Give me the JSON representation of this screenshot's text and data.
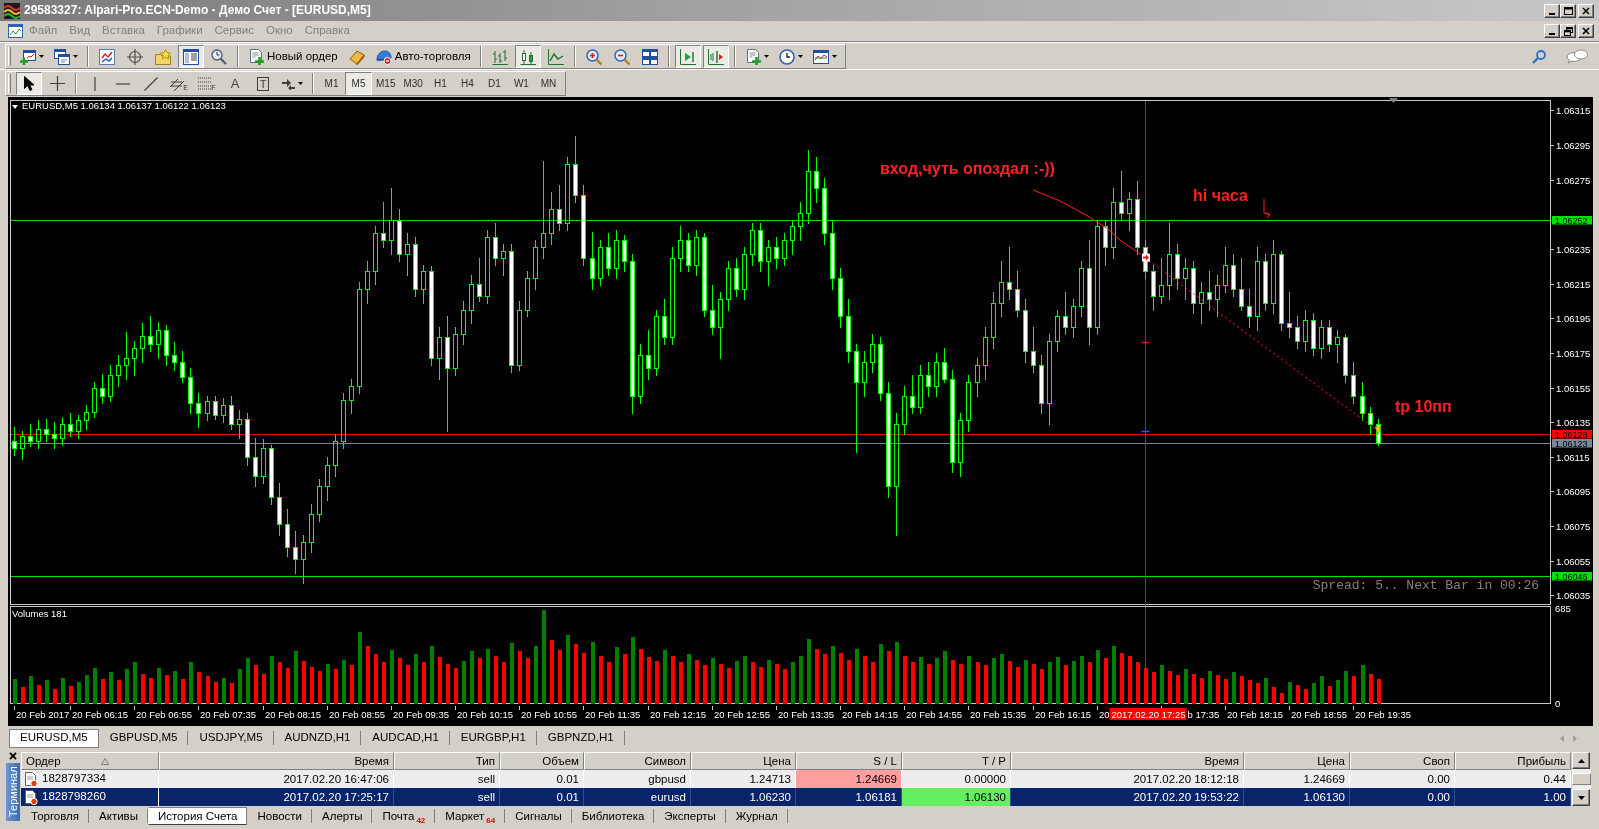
{
  "window": {
    "title": "29583327: Alpari-Pro.ECN-Demo - Демо Счет - [EURUSD,M5]"
  },
  "menu": [
    "Файл",
    "Вид",
    "Вставка",
    "Графики",
    "Сервис",
    "Окно",
    "Справка"
  ],
  "toolbar": [
    [
      {
        "kind": "new-chart",
        "pressed": false
      },
      {
        "kind": "profiles",
        "pressed": false
      }
    ],
    [
      {
        "kind": "market-watch",
        "pressed": false
      },
      {
        "kind": "data-window",
        "pressed": false
      },
      {
        "kind": "navigator",
        "pressed": false
      },
      {
        "kind": "terminal",
        "pressed": true
      },
      {
        "kind": "tester",
        "pressed": false
      }
    ],
    [
      {
        "kind": "new-order",
        "label": "Новый ордер",
        "pressed": false
      },
      {
        "kind": "editor",
        "pressed": false
      },
      {
        "kind": "autotrading",
        "label": "Авто-торговля",
        "pressed": false
      }
    ],
    [
      {
        "kind": "bars",
        "pressed": false
      },
      {
        "kind": "candles",
        "pressed": true
      },
      {
        "kind": "line",
        "pressed": false
      }
    ],
    [
      {
        "kind": "zoom-in",
        "pressed": false
      },
      {
        "kind": "zoom-out",
        "pressed": false
      },
      {
        "kind": "tile",
        "pressed": false
      }
    ],
    [
      {
        "kind": "autoscroll",
        "pressed": true
      },
      {
        "kind": "shift",
        "pressed": true
      }
    ],
    [
      {
        "kind": "indicators",
        "pressed": false
      },
      {
        "kind": "periods",
        "pressed": false
      },
      {
        "kind": "templates",
        "pressed": false
      }
    ]
  ],
  "drawing_tools": [
    [
      {
        "kind": "cursor",
        "selected": true
      },
      {
        "kind": "crosshair",
        "selected": false
      }
    ],
    [
      {
        "kind": "vline",
        "selected": false
      },
      {
        "kind": "hline",
        "selected": false
      },
      {
        "kind": "trendline",
        "selected": false
      },
      {
        "kind": "channel",
        "glyph": "E",
        "selected": false
      },
      {
        "kind": "fibo",
        "glyph": "F",
        "selected": false
      },
      {
        "kind": "text",
        "glyph": "A",
        "selected": false
      },
      {
        "kind": "label",
        "glyph": "T",
        "selected": false
      },
      {
        "kind": "arrows",
        "selected": false
      }
    ]
  ],
  "timeframes": [
    {
      "label": "M1",
      "selected": false
    },
    {
      "label": "M5",
      "selected": true
    },
    {
      "label": "M15",
      "selected": false
    },
    {
      "label": "M30",
      "selected": false
    },
    {
      "label": "H1",
      "selected": false
    },
    {
      "label": "H4",
      "selected": false
    },
    {
      "label": "D1",
      "selected": false
    },
    {
      "label": "W1",
      "selected": false
    },
    {
      "label": "MN",
      "selected": false
    }
  ],
  "chart": {
    "comment": "Spread: 5.. Next Bar in 00:26",
    "chart_data": [
      {
        "type": "candlestick",
        "title": "EURUSD,M5 1.06134 1.06137 1.06122 1.06123",
        "color": "#00ff00",
        "tick_labels": "y",
        "ylim": [
          1.0603,
          1.06321
        ],
        "yticks": [
          1.06035,
          1.06055,
          1.06075,
          1.06095,
          1.06115,
          1.06135,
          1.06155,
          1.06175,
          1.06195,
          1.06215,
          1.06235,
          1.06275,
          1.06295,
          1.06315
        ],
        "ohlc": [
          [
            1.06124,
            1.06132,
            1.06116,
            1.0612
          ],
          [
            1.0612,
            1.0613,
            1.06114,
            1.06127
          ],
          [
            1.06127,
            1.06134,
            1.06121,
            1.06124
          ],
          [
            1.06124,
            1.06136,
            1.0612,
            1.06131
          ],
          [
            1.06131,
            1.06137,
            1.06124,
            1.06128
          ],
          [
            1.06128,
            1.06135,
            1.0612,
            1.06126
          ],
          [
            1.06126,
            1.06138,
            1.06122,
            1.06134
          ],
          [
            1.06134,
            1.0614,
            1.06127,
            1.0613
          ],
          [
            1.0613,
            1.06139,
            1.06126,
            1.06136
          ],
          [
            1.06136,
            1.06145,
            1.06131,
            1.06141
          ],
          [
            1.06141,
            1.06158,
            1.06138,
            1.06155
          ],
          [
            1.06155,
            1.06163,
            1.06146,
            1.0615
          ],
          [
            1.0615,
            1.06168,
            1.06147,
            1.06162
          ],
          [
            1.06162,
            1.06174,
            1.06156,
            1.06168
          ],
          [
            1.06168,
            1.06187,
            1.0616,
            1.06172
          ],
          [
            1.06172,
            1.06182,
            1.06162,
            1.06178
          ],
          [
            1.06178,
            1.06192,
            1.0617,
            1.06185
          ],
          [
            1.06185,
            1.06196,
            1.06176,
            1.0618
          ],
          [
            1.0618,
            1.06193,
            1.06172,
            1.06188
          ],
          [
            1.06188,
            1.06191,
            1.06168,
            1.06174
          ],
          [
            1.06174,
            1.06181,
            1.06165,
            1.0617
          ],
          [
            1.0617,
            1.06176,
            1.06158,
            1.06161
          ],
          [
            1.06161,
            1.06166,
            1.0614,
            1.06146
          ],
          [
            1.06146,
            1.06152,
            1.06132,
            1.0614
          ],
          [
            1.0614,
            1.0615,
            1.06136,
            1.06147
          ],
          [
            1.06147,
            1.0615,
            1.06137,
            1.06139
          ],
          [
            1.06139,
            1.06149,
            1.06135,
            1.06145
          ],
          [
            1.06145,
            1.0615,
            1.06131,
            1.06134
          ],
          [
            1.06134,
            1.06142,
            1.06126,
            1.06137
          ],
          [
            1.06137,
            1.0614,
            1.0611,
            1.06115
          ],
          [
            1.06115,
            1.06126,
            1.06098,
            1.06104
          ],
          [
            1.06104,
            1.06125,
            1.061,
            1.0612
          ],
          [
            1.0612,
            1.06122,
            1.06088,
            1.06092
          ],
          [
            1.06092,
            1.061,
            1.0607,
            1.06076
          ],
          [
            1.06076,
            1.06085,
            1.06058,
            1.06063
          ],
          [
            1.06063,
            1.06072,
            1.06048,
            1.06056
          ],
          [
            1.06056,
            1.0607,
            1.06042,
            1.06066
          ],
          [
            1.06066,
            1.06088,
            1.0606,
            1.06082
          ],
          [
            1.06082,
            1.06102,
            1.06078,
            1.06098
          ],
          [
            1.06098,
            1.06115,
            1.0609,
            1.0611
          ],
          [
            1.0611,
            1.06128,
            1.06104,
            1.06124
          ],
          [
            1.06124,
            1.06152,
            1.0612,
            1.06148
          ],
          [
            1.06148,
            1.0616,
            1.0614,
            1.06156
          ],
          [
            1.06156,
            1.06216,
            1.06152,
            1.06212
          ],
          [
            1.06212,
            1.06228,
            1.06204,
            1.06222
          ],
          [
            1.06222,
            1.06248,
            1.06215,
            1.06244
          ],
          [
            1.06244,
            1.06262,
            1.06236,
            1.0624
          ],
          [
            1.0624,
            1.0627,
            1.06232,
            1.06252
          ],
          [
            1.06252,
            1.06258,
            1.06228,
            1.06232
          ],
          [
            1.06232,
            1.06244,
            1.0622,
            1.06238
          ],
          [
            1.06238,
            1.06242,
            1.06208,
            1.06212
          ],
          [
            1.06212,
            1.06226,
            1.06204,
            1.06222
          ],
          [
            1.06222,
            1.06225,
            1.06168,
            1.06172
          ],
          [
            1.06172,
            1.0619,
            1.0616,
            1.06184
          ],
          [
            1.06184,
            1.06196,
            1.0613,
            1.06166
          ],
          [
            1.06166,
            1.0619,
            1.06162,
            1.06186
          ],
          [
            1.06186,
            1.06205,
            1.0618,
            1.062
          ],
          [
            1.062,
            1.0622,
            1.06192,
            1.06215
          ],
          [
            1.06215,
            1.0623,
            1.06205,
            1.06208
          ],
          [
            1.06208,
            1.06246,
            1.06204,
            1.06242
          ],
          [
            1.06242,
            1.0625,
            1.06226,
            1.0623
          ],
          [
            1.0623,
            1.06238,
            1.0622,
            1.06234
          ],
          [
            1.06234,
            1.06238,
            1.06164,
            1.06168
          ],
          [
            1.06168,
            1.06205,
            1.06165,
            1.062
          ],
          [
            1.062,
            1.06222,
            1.06196,
            1.06218
          ],
          [
            1.06218,
            1.0624,
            1.06212,
            1.06236
          ],
          [
            1.06236,
            1.06286,
            1.0623,
            1.06244
          ],
          [
            1.06244,
            1.06268,
            1.06238,
            1.06258
          ],
          [
            1.06258,
            1.06272,
            1.06246,
            1.0625
          ],
          [
            1.0625,
            1.06288,
            1.06246,
            1.06284
          ],
          [
            1.06284,
            1.063,
            1.06262,
            1.06266
          ],
          [
            1.06266,
            1.06272,
            1.06226,
            1.0623
          ],
          [
            1.0623,
            1.06245,
            1.06212,
            1.06218
          ],
          [
            1.06218,
            1.0624,
            1.06214,
            1.06236
          ],
          [
            1.06236,
            1.06244,
            1.0622,
            1.06224
          ],
          [
            1.06224,
            1.06246,
            1.06218,
            1.0624
          ],
          [
            1.0624,
            1.06243,
            1.06222,
            1.06228
          ],
          [
            1.06228,
            1.06232,
            1.0614,
            1.0615
          ],
          [
            1.0615,
            1.0618,
            1.06146,
            1.06174
          ],
          [
            1.06174,
            1.06188,
            1.0616,
            1.06166
          ],
          [
            1.06166,
            1.062,
            1.06162,
            1.06196
          ],
          [
            1.06196,
            1.06206,
            1.0618,
            1.06184
          ],
          [
            1.06184,
            1.06236,
            1.0618,
            1.0623
          ],
          [
            1.0623,
            1.06248,
            1.06222,
            1.0624
          ],
          [
            1.0624,
            1.06244,
            1.06222,
            1.06226
          ],
          [
            1.06226,
            1.06246,
            1.0622,
            1.06242
          ],
          [
            1.06242,
            1.06244,
            1.06196,
            1.062
          ],
          [
            1.062,
            1.06214,
            1.06186,
            1.0619
          ],
          [
            1.0619,
            1.0621,
            1.06172,
            1.06206
          ],
          [
            1.06206,
            1.06228,
            1.062,
            1.06224
          ],
          [
            1.06224,
            1.0623,
            1.06208,
            1.06212
          ],
          [
            1.06212,
            1.06236,
            1.06206,
            1.06232
          ],
          [
            1.06232,
            1.0625,
            1.06226,
            1.06246
          ],
          [
            1.06246,
            1.0625,
            1.06222,
            1.06228
          ],
          [
            1.06228,
            1.0624,
            1.06214,
            1.06236
          ],
          [
            1.06236,
            1.06242,
            1.06224,
            1.0623
          ],
          [
            1.0623,
            1.06244,
            1.06226,
            1.0624
          ],
          [
            1.0624,
            1.06252,
            1.06232,
            1.06248
          ],
          [
            1.06248,
            1.06262,
            1.0624,
            1.06256
          ],
          [
            1.06256,
            1.06292,
            1.0625,
            1.0628
          ],
          [
            1.0628,
            1.06288,
            1.06262,
            1.0627
          ],
          [
            1.0627,
            1.06276,
            1.06238,
            1.06244
          ],
          [
            1.06244,
            1.06252,
            1.06212,
            1.06218
          ],
          [
            1.06218,
            1.06224,
            1.0619,
            1.06196
          ],
          [
            1.06196,
            1.06206,
            1.0617,
            1.06176
          ],
          [
            1.06176,
            1.0618,
            1.06118,
            1.06158
          ],
          [
            1.06158,
            1.06176,
            1.0615,
            1.0617
          ],
          [
            1.0617,
            1.06186,
            1.06164,
            1.0618
          ],
          [
            1.0618,
            1.06184,
            1.06148,
            1.06152
          ],
          [
            1.06152,
            1.06158,
            1.06092,
            1.06098
          ],
          [
            1.06098,
            1.0614,
            1.0607,
            1.06134
          ],
          [
            1.06134,
            1.06156,
            1.06128,
            1.0615
          ],
          [
            1.0615,
            1.06162,
            1.0614,
            1.06144
          ],
          [
            1.06144,
            1.06168,
            1.0614,
            1.06162
          ],
          [
            1.06162,
            1.0617,
            1.0615,
            1.06156
          ],
          [
            1.06156,
            1.06175,
            1.0615,
            1.0617
          ],
          [
            1.0617,
            1.06178,
            1.06158,
            1.0616
          ],
          [
            1.0616,
            1.06165,
            1.06106,
            1.06112
          ],
          [
            1.06112,
            1.0614,
            1.06104,
            1.06136
          ],
          [
            1.06136,
            1.06162,
            1.0613,
            1.06158
          ],
          [
            1.06158,
            1.06172,
            1.0615,
            1.06168
          ],
          [
            1.06168,
            1.0619,
            1.0616,
            1.06184
          ],
          [
            1.06184,
            1.0621,
            1.06178,
            1.06204
          ],
          [
            1.06204,
            1.06228,
            1.06196,
            1.06216
          ],
          [
            1.06216,
            1.06236,
            1.06206,
            1.06212
          ],
          [
            1.06212,
            1.06222,
            1.06196,
            1.062
          ],
          [
            1.062,
            1.06206,
            1.0617,
            1.06176
          ],
          [
            1.06176,
            1.0619,
            1.06164,
            1.06168
          ],
          [
            1.06168,
            1.06174,
            1.0614,
            1.06146
          ],
          [
            1.06146,
            1.06186,
            1.06134,
            1.06182
          ],
          [
            1.06182,
            1.062,
            1.06176,
            1.06196
          ],
          [
            1.06196,
            1.0621,
            1.06186,
            1.0619
          ],
          [
            1.0619,
            1.06206,
            1.06184,
            1.06202
          ],
          [
            1.06202,
            1.06228,
            1.06196,
            1.06224
          ],
          [
            1.06224,
            1.0624,
            1.0618,
            1.0619
          ],
          [
            1.0619,
            1.06252,
            1.06186,
            1.06248
          ],
          [
            1.06248,
            1.06252,
            1.06226,
            1.06236
          ],
          [
            1.06236,
            1.0627,
            1.0623,
            1.06262
          ],
          [
            1.06262,
            1.0628,
            1.06252,
            1.06256
          ],
          [
            1.06256,
            1.06268,
            1.06246,
            1.06264
          ],
          [
            1.06264,
            1.06274,
            1.06232,
            1.06236
          ],
          [
            1.06236,
            1.0624,
            1.06218,
            1.06222
          ],
          [
            1.06222,
            1.06226,
            1.062,
            1.06208
          ],
          [
            1.06208,
            1.0623,
            1.06204,
            1.06214
          ],
          [
            1.06214,
            1.0625,
            1.06206,
            1.06232
          ],
          [
            1.06232,
            1.06238,
            1.06212,
            1.06218
          ],
          [
            1.06218,
            1.0623,
            1.06206,
            1.06224
          ],
          [
            1.06224,
            1.06228,
            1.06198,
            1.06204
          ],
          [
            1.06204,
            1.06216,
            1.06192,
            1.0621
          ],
          [
            1.0621,
            1.06222,
            1.062,
            1.06206
          ],
          [
            1.06206,
            1.0622,
            1.06196,
            1.06214
          ],
          [
            1.06214,
            1.06236,
            1.0621,
            1.06226
          ],
          [
            1.06226,
            1.06232,
            1.06208,
            1.06212
          ],
          [
            1.06212,
            1.0623,
            1.062,
            1.06202
          ],
          [
            1.06202,
            1.06212,
            1.0619,
            1.06196
          ],
          [
            1.06196,
            1.06236,
            1.06188,
            1.06228
          ],
          [
            1.06228,
            1.06232,
            1.062,
            1.06204
          ],
          [
            1.06204,
            1.0624,
            1.06198,
            1.06232
          ],
          [
            1.06232,
            1.06234,
            1.06188,
            1.06192
          ],
          [
            1.06192,
            1.0621,
            1.06184,
            1.0619
          ],
          [
            1.0619,
            1.06196,
            1.06178,
            1.06182
          ],
          [
            1.06182,
            1.062,
            1.06176,
            1.06194
          ],
          [
            1.06194,
            1.06198,
            1.06174,
            1.06178
          ],
          [
            1.06178,
            1.06194,
            1.06172,
            1.0619
          ],
          [
            1.0619,
            1.06194,
            1.06176,
            1.0618
          ],
          [
            1.0618,
            1.06188,
            1.0617,
            1.06184
          ],
          [
            1.06184,
            1.06186,
            1.06158,
            1.06162
          ],
          [
            1.06162,
            1.0617,
            1.06146,
            1.0615
          ],
          [
            1.0615,
            1.06158,
            1.06136,
            1.0614
          ],
          [
            1.0614,
            1.06144,
            1.06128,
            1.06134
          ],
          [
            1.06134,
            1.06137,
            1.06122,
            1.06123
          ],
          null,
          null,
          null,
          null,
          null,
          null,
          null,
          null,
          null,
          null,
          null,
          null,
          null,
          null,
          null,
          null,
          null,
          null,
          null,
          null,
          null
        ],
        "ref_lines": [
          {
            "axis": "y",
            "value": 1.06252,
            "label": "1.06252",
            "color": "#00e000"
          },
          {
            "axis": "y",
            "value": 1.06128,
            "label": "1.06128",
            "color": "#ff0000"
          },
          {
            "axis": "y",
            "value": 1.06123,
            "label": "1.06123",
            "color": "#778899"
          },
          {
            "axis": "y",
            "value": 1.06046,
            "label": "1.06046",
            "color": "#00e000"
          }
        ],
        "annotations": [
          "вход,чуть опоздал :-))",
          "hi часа",
          "tp 10пп"
        ]
      },
      {
        "type": "bar",
        "title": "Volumes 181",
        "ylim": [
          0,
          700
        ],
        "yticks": [
          {
            "value": 0,
            "label": "0"
          },
          {
            "value": 685,
            "label": "685"
          }
        ],
        "values": [
          180,
          120,
          200,
          140,
          170,
          110,
          190,
          130,
          160,
          210,
          260,
          180,
          230,
          170,
          250,
          300,
          220,
          190,
          260,
          210,
          240,
          180,
          300,
          230,
          200,
          160,
          190,
          150,
          250,
          330,
          280,
          220,
          350,
          300,
          260,
          380,
          310,
          270,
          240,
          290,
          250,
          320,
          280,
          520,
          420,
          360,
          300,
          390,
          330,
          280,
          360,
          300,
          420,
          340,
          290,
          260,
          310,
          380,
          330,
          400,
          350,
          300,
          440,
          380,
          330,
          420,
          680,
          460,
          390,
          500,
          430,
          370,
          450,
          350,
          300,
          410,
          360,
          480,
          400,
          340,
          310,
          390,
          350,
          300,
          360,
          320,
          280,
          330,
          290,
          260,
          310,
          350,
          300,
          270,
          320,
          290,
          250,
          300,
          350,
          470,
          400,
          360,
          420,
          370,
          320,
          400,
          350,
          300,
          430,
          380,
          450,
          350,
          300,
          340,
          290,
          330,
          380,
          320,
          290,
          350,
          300,
          280,
          330,
          360,
          310,
          270,
          320,
          290,
          250,
          300,
          340,
          280,
          310,
          350,
          300,
          390,
          330,
          420,
          370,
          350,
          300,
          260,
          230,
          280,
          240,
          210,
          250,
          220,
          190,
          240,
          210,
          180,
          230,
          200,
          170,
          150,
          190,
          120,
          80,
          160,
          140,
          110,
          150,
          200,
          130,
          170,
          240,
          200,
          280,
          220,
          181,
          null,
          null,
          null,
          null,
          null,
          null,
          null,
          null,
          null,
          null,
          null,
          null,
          null,
          null,
          null,
          null,
          null,
          null,
          null,
          null,
          null
        ],
        "colors": [
          "#008000",
          "#ff0000",
          "#008000",
          "#ff0000",
          "#008000",
          "#ff0000",
          "#008000",
          "#ff0000",
          "#008000",
          "#008000",
          "#008000",
          "#ff0000",
          "#008000",
          "#ff0000",
          "#008000",
          "#008000",
          "#ff0000",
          "#ff0000",
          "#008000",
          "#ff0000",
          "#008000",
          "#ff0000",
          "#008000",
          "#ff0000",
          "#ff0000",
          "#ff0000",
          "#008000",
          "#ff0000",
          "#008000",
          "#008000",
          "#ff0000",
          "#ff0000",
          "#008000",
          "#ff0000",
          "#ff0000",
          "#008000",
          "#ff0000",
          "#ff0000",
          "#ff0000",
          "#008000",
          "#ff0000",
          "#008000",
          "#ff0000",
          "#008000",
          "#ff0000",
          "#ff0000",
          "#ff0000",
          "#008000",
          "#ff0000",
          "#ff0000",
          "#008000",
          "#ff0000",
          "#008000",
          "#ff0000",
          "#ff0000",
          "#ff0000",
          "#008000",
          "#008000",
          "#ff0000",
          "#008000",
          "#ff0000",
          "#ff0000",
          "#008000",
          "#ff0000",
          "#ff0000",
          "#008000",
          "#008000",
          "#ff0000",
          "#ff0000",
          "#008000",
          "#ff0000",
          "#ff0000",
          "#008000",
          "#ff0000",
          "#ff0000",
          "#008000",
          "#ff0000",
          "#008000",
          "#ff0000",
          "#ff0000",
          "#ff0000",
          "#008000",
          "#ff0000",
          "#ff0000",
          "#008000",
          "#ff0000",
          "#ff0000",
          "#008000",
          "#ff0000",
          "#ff0000",
          "#008000",
          "#008000",
          "#ff0000",
          "#ff0000",
          "#008000",
          "#ff0000",
          "#ff0000",
          "#008000",
          "#008000",
          "#008000",
          "#ff0000",
          "#ff0000",
          "#008000",
          "#ff0000",
          "#ff0000",
          "#008000",
          "#ff0000",
          "#ff0000",
          "#008000",
          "#ff0000",
          "#008000",
          "#ff0000",
          "#ff0000",
          "#008000",
          "#ff0000",
          "#008000",
          "#008000",
          "#ff0000",
          "#ff0000",
          "#008000",
          "#ff0000",
          "#ff0000",
          "#008000",
          "#008000",
          "#ff0000",
          "#ff0000",
          "#008000",
          "#ff0000",
          "#ff0000",
          "#008000",
          "#008000",
          "#ff0000",
          "#008000",
          "#008000",
          "#ff0000",
          "#008000",
          "#ff0000",
          "#008000",
          "#ff0000",
          "#ff0000",
          "#ff0000",
          "#ff0000",
          "#ff0000",
          "#008000",
          "#ff0000",
          "#ff0000",
          "#008000",
          "#ff0000",
          "#ff0000",
          "#008000",
          "#ff0000",
          "#ff0000",
          "#008000",
          "#ff0000",
          "#ff0000",
          "#ff0000",
          "#008000",
          "#ff0000",
          "#ff0000",
          "#008000",
          "#ff0000",
          "#ff0000",
          "#008000",
          "#008000",
          "#ff0000",
          "#008000",
          "#008000",
          "#ff0000",
          "#008000",
          "#ff0000",
          "#ff0000",
          null,
          null,
          null,
          null,
          null,
          null,
          null,
          null,
          null,
          null,
          null,
          null,
          null,
          null,
          null,
          null,
          null,
          null,
          null,
          null,
          null
        ]
      }
    ],
    "time_axis": [
      {
        "label": "20 Feb 2017",
        "highlighted": false
      },
      {
        "label": "20 Feb 06:15",
        "highlighted": false
      },
      {
        "label": "20 Feb 06:55",
        "highlighted": false
      },
      {
        "label": "20 Feb 07:35",
        "highlighted": false
      },
      {
        "label": "20 Feb 08:15",
        "highlighted": false
      },
      {
        "label": "20 Feb 08:55",
        "highlighted": false
      },
      {
        "label": "20 Feb 09:35",
        "highlighted": false
      },
      {
        "label": "20 Feb 10:15",
        "highlighted": false
      },
      {
        "label": "20 Feb 10:55",
        "highlighted": false
      },
      {
        "label": "20 Feb 11:35",
        "highlighted": false
      },
      {
        "label": "20 Feb 12:15",
        "highlighted": false
      },
      {
        "label": "20 Feb 12:55",
        "highlighted": false
      },
      {
        "label": "20 Feb 13:35",
        "highlighted": false
      },
      {
        "label": "20 Feb 14:15",
        "highlighted": false
      },
      {
        "label": "20 Feb 14:55",
        "highlighted": false
      },
      {
        "label": "20 Feb 15:35",
        "highlighted": false
      },
      {
        "label": "20 Feb 16:15",
        "highlighted": false
      },
      {
        "label": "20",
        "highlighted": false
      },
      {
        "label": "2017.02.20 17:25",
        "highlighted": true
      },
      {
        "label": "b 17:35",
        "highlighted": false
      },
      {
        "label": "20 Feb 18:15",
        "highlighted": false
      },
      {
        "label": "20 Feb 18:55",
        "highlighted": false
      },
      {
        "label": "20 Feb 19:35",
        "highlighted": false
      }
    ]
  },
  "chart_tabs": [
    {
      "label": "EURUSD,M5",
      "selected": true
    },
    {
      "label": "GBPUSD,M5",
      "selected": false
    },
    {
      "label": "USDJPY,M5",
      "selected": false
    },
    {
      "label": "AUDNZD,H1",
      "selected": false
    },
    {
      "label": "AUDCAD,H1",
      "selected": false
    },
    {
      "label": "EURGBP,H1",
      "selected": false
    },
    {
      "label": "GBPNZD,H1",
      "selected": false
    }
  ],
  "terminal": {
    "title": "Терминал",
    "columns": [
      {
        "label": "Ордер",
        "sorted": true
      },
      {
        "label": "Время",
        "sorted": false
      },
      {
        "label": "Тип",
        "sorted": false
      },
      {
        "label": "Объем",
        "sorted": false
      },
      {
        "label": "Символ",
        "sorted": false
      },
      {
        "label": "Цена",
        "sorted": false
      },
      {
        "label": "S / L",
        "sorted": false
      },
      {
        "label": "T / P",
        "sorted": false
      },
      {
        "label": "Время",
        "sorted": false
      },
      {
        "label": "Цена",
        "sorted": false
      },
      {
        "label": "Своп",
        "sorted": false
      },
      {
        "label": "Прибыль",
        "sorted": false
      }
    ],
    "rows": [
      {
        "selected": false,
        "sl_hit": true,
        "tp_hit": false,
        "cells": [
          "1828797334",
          "2017.02.20 16:47:06",
          "sell",
          "0.01",
          "gbpusd",
          "1.24713",
          "1.24669",
          "0.00000",
          "2017.02.20 18:12:18",
          "1.24669",
          "0.00",
          "0.44"
        ]
      },
      {
        "selected": true,
        "sl_hit": false,
        "tp_hit": true,
        "cells": [
          "1828798260",
          "2017.02.20 17:25:17",
          "sell",
          "0.01",
          "eurusd",
          "1.06230",
          "1.06181",
          "1.06130",
          "2017.02.20 19:53:22",
          "1.06130",
          "0.00",
          "1.00"
        ]
      }
    ],
    "tabs": [
      {
        "label": "Торговля",
        "selected": false
      },
      {
        "label": "Активы",
        "selected": false
      },
      {
        "label": "История Счета",
        "selected": true
      },
      {
        "label": "Новости",
        "selected": false
      },
      {
        "label": "Алерты",
        "selected": false
      },
      {
        "label": "Почта",
        "count": "42",
        "selected": false
      },
      {
        "label": "Маркет",
        "count": "64",
        "selected": false
      },
      {
        "label": "Сигналы",
        "selected": false
      },
      {
        "label": "Библиотека",
        "selected": false
      },
      {
        "label": "Эксперты",
        "selected": false
      },
      {
        "label": "Журнал",
        "selected": false
      }
    ]
  }
}
